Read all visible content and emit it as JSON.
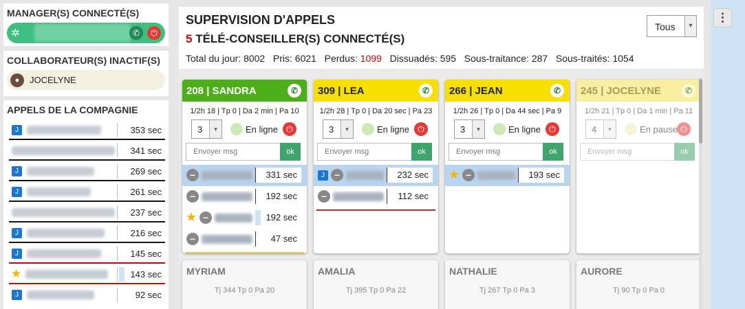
{
  "sidebar": {
    "managers_title": "MANAGER(S) CONNECTÉ(S)",
    "inactive_title": "COLLABORATEUR(S) INACTIF(S)",
    "inactive_user": "JOCELYNE",
    "company_title": "APPELS DE LA COMPAGNIE",
    "company_calls": [
      {
        "value": "353 sec",
        "icon": "phone-app-icon",
        "underline": "black"
      },
      {
        "value": "341 sec",
        "icon": "",
        "underline": "black"
      },
      {
        "value": "269 sec",
        "icon": "phone-app-icon",
        "underline": "black"
      },
      {
        "value": "261 sec",
        "icon": "phone-app-icon",
        "underline": "black"
      },
      {
        "value": "237 sec",
        "icon": "",
        "underline": "black"
      },
      {
        "value": "216 sec",
        "icon": "phone-app-icon",
        "underline": "black"
      },
      {
        "value": "145 sec",
        "icon": "phone-app-icon",
        "underline": "red"
      },
      {
        "value": "143 sec",
        "icon": "star-icon",
        "underline": "red"
      },
      {
        "value": "92 sec",
        "icon": "phone-app-icon",
        "underline": ""
      }
    ]
  },
  "header": {
    "title": "SUPERVISION D'APPELS",
    "connected_count": "5",
    "connected_label": "TÉLÉ-CONSEILLER(S) CONNECTÉ(S)",
    "stats": {
      "total_label": "Total du jour:",
      "total": "8002",
      "pris_label": "Pris:",
      "pris": "6021",
      "perdus_label": "Perdus:",
      "perdus": "1099",
      "dissuades_label": "Dissuadés:",
      "dissuades": "595",
      "soustraitance_label": "Sous-traitance:",
      "soustraitance": "287",
      "soustraites_label": "Sous-traités:",
      "soustraites": "1054"
    },
    "filter": "Tous"
  },
  "agents": [
    {
      "title": "208 | SANDRA",
      "color": "#4caf1a",
      "text_color": "#ffffff",
      "stats": "1/2h 18 | Tp 0 | Da 2 min | Pa 10",
      "level": "3",
      "status": "En ligne",
      "msg_placeholder": "Envoyer msg",
      "ok": "ok",
      "underline": "#f2c744",
      "calls": [
        {
          "dur": "331 sec",
          "hi": true,
          "icon": ""
        },
        {
          "dur": "192 sec",
          "hi": false,
          "icon": ""
        },
        {
          "dur": "192 sec",
          "hi": false,
          "icon": "star"
        },
        {
          "dur": "47 sec",
          "hi": false,
          "icon": ""
        }
      ]
    },
    {
      "title": "309 | LEA",
      "color": "#f7e000",
      "text_color": "#222222",
      "stats": "1/2h 28 | Tp 0 | Da 20 sec | Pa 23",
      "level": "3",
      "status": "En ligne",
      "msg_placeholder": "Envoyer msg",
      "ok": "ok",
      "underline": "#c62828",
      "calls": [
        {
          "dur": "232 sec",
          "hi": true,
          "icon": "phone"
        },
        {
          "dur": "112 sec",
          "hi": false,
          "icon": ""
        }
      ]
    },
    {
      "title": "266 | JEAN",
      "color": "#f7e000",
      "text_color": "#222222",
      "stats": "1/2h 26 | Tp 0 | Da 44 sec | Pa 9",
      "level": "3",
      "status": "En ligne",
      "msg_placeholder": "Envoyer msg",
      "ok": "ok",
      "underline": "",
      "calls": [
        {
          "dur": "193 sec",
          "hi": true,
          "icon": "star"
        }
      ]
    },
    {
      "title": "245 | JOCELYNE",
      "color": "#faeea0",
      "text_color": "#a89b5a",
      "stats": "1/2h 21 | Tp 0 | Da 1 min | Pa 11",
      "level": "4",
      "status": "En pause",
      "msg_placeholder": "Envoyer msg",
      "ok": "ok",
      "underline": "",
      "calls": []
    }
  ],
  "offline_agents": [
    {
      "name": "MYRIAM",
      "stats": "Tj 344 Tp 0 Pa 20"
    },
    {
      "name": "AMALIA",
      "stats": "Tj 395 Tp 0 Pa 22"
    },
    {
      "name": "NATHALIE",
      "stats": "Tj 267 Tp 0 Pa 3"
    },
    {
      "name": "AURORE",
      "stats": "Tj 90 Tp 0 Pa 0"
    }
  ]
}
